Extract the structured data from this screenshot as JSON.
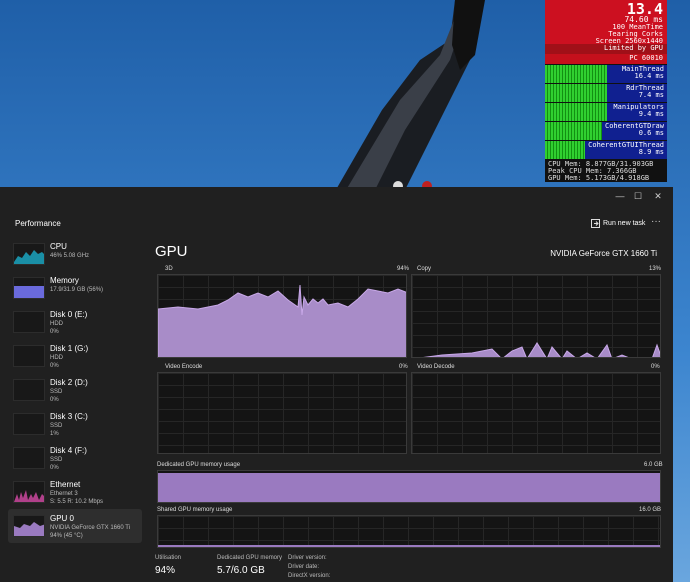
{
  "overlay": {
    "fps": "13.4",
    "frame_ms": "74.60 ms",
    "line3": "100 MeanTime",
    "line4": "Tearing Corks",
    "line5": "Screen 2560x1440",
    "line6": "Post 2560x1440",
    "line7": "Render 2560x1440",
    "limited": "Limited by GPU",
    "pc": "PC 60010",
    "rows": [
      {
        "label": "MainThread",
        "value": "16.4 ms"
      },
      {
        "label": "RdrThread",
        "value": "7.4 ms"
      },
      {
        "label": "Manipulators",
        "value": "9.4 ms"
      },
      {
        "label": "CoherentGTDraw",
        "value": "0.6 ms"
      },
      {
        "label": "CoherentGTUIThread",
        "value": "8.9 ms"
      }
    ],
    "time": "[ 0:38:39.8] 90%=18.3",
    "gpu_row": "148.7 ms",
    "cpu_mem": "CPU Mem: 8.877GB/31.903GB",
    "peak_cpu": "Peak CPU Mem: 7.366GB",
    "gpu_mem": "GPU Mem: 5.173GB/4.918GB"
  },
  "window": {
    "title": "Performance",
    "run_new_task": "Run new task",
    "more": "···",
    "controls": [
      "—",
      "☐",
      "✕"
    ]
  },
  "sidebar": {
    "items": [
      {
        "name": "CPU",
        "sub1": "46% 5.08 GHz",
        "sub2": "",
        "color": "#1a8fa6"
      },
      {
        "name": "Memory",
        "sub1": "17.9/31.9 GB (56%)",
        "sub2": "",
        "color": "#6a6adc"
      },
      {
        "name": "Disk 0 (E:)",
        "sub1": "HDD",
        "sub2": "0%",
        "color": "#5a8a3a"
      },
      {
        "name": "Disk 1 (G:)",
        "sub1": "HDD",
        "sub2": "0%",
        "color": "#5a8a3a"
      },
      {
        "name": "Disk 2 (D:)",
        "sub1": "SSD",
        "sub2": "0%",
        "color": "#5a8a3a"
      },
      {
        "name": "Disk 3 (C:)",
        "sub1": "SSD",
        "sub2": "1%",
        "color": "#5a8a3a"
      },
      {
        "name": "Disk 4 (F:)",
        "sub1": "SSD",
        "sub2": "0%",
        "color": "#5a8a3a"
      },
      {
        "name": "Ethernet",
        "sub1": "Ethernet 3",
        "sub2": "S: 5.5  R: 10.2 Mbps",
        "color": "#b0408a"
      },
      {
        "name": "GPU 0",
        "sub1": "NVIDIA GeForce GTX 1660 Ti",
        "sub2": "94% (45 °C)",
        "color": "#9a7ac0"
      }
    ]
  },
  "main": {
    "title": "GPU",
    "gpu_name": "NVIDIA GeForce GTX 1660 Ti",
    "graphs": {
      "g3d": {
        "label": "3D",
        "value": "94%"
      },
      "copy": {
        "label": "Copy",
        "value": "13%"
      },
      "encode": {
        "label": "Video Encode",
        "value": "0%"
      },
      "decode": {
        "label": "Video Decode",
        "value": "0%"
      }
    },
    "dedicated": {
      "label": "Dedicated GPU memory usage",
      "max": "6.0 GB",
      "level": 0.95
    },
    "shared": {
      "label": "Shared GPU memory usage",
      "max": "16.0 GB",
      "level": 0.08
    },
    "stats": {
      "util_label": "Utilisation",
      "util_value": "94%",
      "ded_label": "Dedicated GPU memory",
      "ded_value": "5.7/6.0 GB",
      "driver_version": "Driver version:",
      "driver_date": "Driver date:",
      "directx": "DirectX version:"
    }
  },
  "colors": {
    "accent": "#9a7ac0",
    "window_bg": "#202020",
    "overlay_red": "#cc1020"
  }
}
